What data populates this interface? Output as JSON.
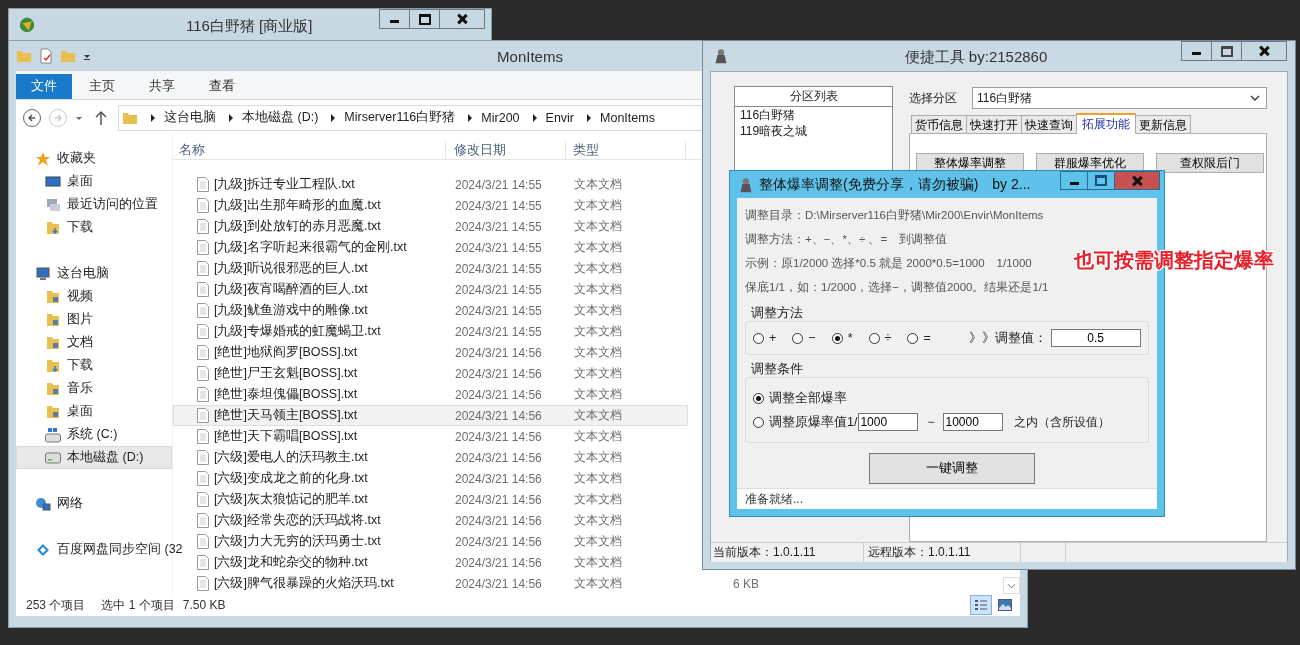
{
  "back_window": {
    "title": "116白野猪 [商业版]"
  },
  "explorer": {
    "title": "MonItems",
    "ribbon_tabs": [
      {
        "label": "文件",
        "selected": true
      },
      {
        "label": "主页",
        "selected": false
      },
      {
        "label": "共享",
        "selected": false
      },
      {
        "label": "查看",
        "selected": false
      }
    ],
    "breadcrumb": [
      "这台电脑",
      "本地磁盘 (D:)",
      "Mirserver116白野猪",
      "Mir200",
      "Envir",
      "MonItems"
    ],
    "nav": [
      {
        "label": "收藏夹",
        "kind": "star",
        "selected": false,
        "children": [
          {
            "label": "桌面",
            "kind": "desktop",
            "selected": false
          },
          {
            "label": "最近访问的位置",
            "kind": "recent",
            "selected": false
          },
          {
            "label": "下载",
            "kind": "download",
            "selected": false
          }
        ]
      },
      {
        "label": "这台电脑",
        "kind": "computer",
        "selected": false,
        "children": [
          {
            "label": "视频",
            "kind": "video",
            "selected": false
          },
          {
            "label": "图片",
            "kind": "pictures",
            "selected": false
          },
          {
            "label": "文档",
            "kind": "documents",
            "selected": false
          },
          {
            "label": "下载",
            "kind": "download",
            "selected": false
          },
          {
            "label": "音乐",
            "kind": "music",
            "selected": false
          },
          {
            "label": "桌面",
            "kind": "desktop",
            "selected": false
          },
          {
            "label": "系统 (C:)",
            "kind": "system-drive",
            "selected": false
          },
          {
            "label": "本地磁盘 (D:)",
            "kind": "drive",
            "selected": true
          }
        ]
      },
      {
        "label": "网络",
        "kind": "network",
        "selected": false
      },
      {
        "label": "百度网盘同步空间 (32",
        "kind": "cloud",
        "selected": false
      }
    ],
    "columns": [
      "名称",
      "修改日期",
      "类型"
    ],
    "rows": [
      {
        "name": "[九级]拆迁专业工程队.txt",
        "modified": "2024/3/21 14:55",
        "type": "文本文档",
        "selected": false
      },
      {
        "name": "[九级]出生那年畸形的血魔.txt",
        "modified": "2024/3/21 14:55",
        "type": "文本文档",
        "selected": false
      },
      {
        "name": "[九级]到处放钉的赤月恶魔.txt",
        "modified": "2024/3/21 14:55",
        "type": "文本文档",
        "selected": false
      },
      {
        "name": "[九级]名字听起来很霸气的金刚.txt",
        "modified": "2024/3/21 14:55",
        "type": "文本文档",
        "selected": false
      },
      {
        "name": "[九级]听说很邪恶的巨人.txt",
        "modified": "2024/3/21 14:55",
        "type": "文本文档",
        "selected": false
      },
      {
        "name": "[九级]夜宵喝醉酒的巨人.txt",
        "modified": "2024/3/21 14:55",
        "type": "文本文档",
        "selected": false
      },
      {
        "name": "[九级]鱿鱼游戏中的雕像.txt",
        "modified": "2024/3/21 14:55",
        "type": "文本文档",
        "selected": false
      },
      {
        "name": "[九级]专爆婚戒的虹魔蝎卫.txt",
        "modified": "2024/3/21 14:55",
        "type": "文本文档",
        "selected": false
      },
      {
        "name": "[绝世]地狱阎罗[BOSS].txt",
        "modified": "2024/3/21 14:56",
        "type": "文本文档",
        "selected": false
      },
      {
        "name": "[绝世]尸王玄魁[BOSS].txt",
        "modified": "2024/3/21 14:56",
        "type": "文本文档",
        "selected": false
      },
      {
        "name": "[绝世]泰坦傀儡[BOSS].txt",
        "modified": "2024/3/21 14:56",
        "type": "文本文档",
        "selected": false
      },
      {
        "name": "[绝世]天马领主[BOSS].txt",
        "modified": "2024/3/21 14:56",
        "type": "文本文档",
        "selected": true
      },
      {
        "name": "[绝世]天下霸唱[BOSS].txt",
        "modified": "2024/3/21 14:56",
        "type": "文本文档",
        "selected": false
      },
      {
        "name": "[六级]爱电人的沃玛教主.txt",
        "modified": "2024/3/21 14:56",
        "type": "文本文档",
        "selected": false
      },
      {
        "name": "[六级]变成龙之前的化身.txt",
        "modified": "2024/3/21 14:56",
        "type": "文本文档",
        "selected": false
      },
      {
        "name": "[六级]灰太狼惦记的肥羊.txt",
        "modified": "2024/3/21 14:56",
        "type": "文本文档",
        "selected": false
      },
      {
        "name": "[六级]经常失恋的沃玛战将.txt",
        "modified": "2024/3/21 14:56",
        "type": "文本文档",
        "selected": false
      },
      {
        "name": "[六级]力大无穷的沃玛勇士.txt",
        "modified": "2024/3/21 14:56",
        "type": "文本文档",
        "selected": false
      },
      {
        "name": "[六级]龙和蛇杂交的物种.txt",
        "modified": "2024/3/21 14:56",
        "type": "文本文档",
        "selected": false
      },
      {
        "name": "[六级]脾气很暴躁的火焰沃玛.txt",
        "modified": "2024/3/21 14:56",
        "type": "文本文档",
        "size": "6 KB",
        "selected": false
      }
    ],
    "status": {
      "count": "253 个项目",
      "selection": "选中 1 个项目",
      "size": "7.50 KB"
    },
    "views": [
      {
        "kind": "details",
        "selected": true
      },
      {
        "kind": "preview",
        "selected": false
      }
    ]
  },
  "tool_window": {
    "title": "便捷工具 by:2152860",
    "partition_list": {
      "header": "分区列表",
      "items": [
        "116白野猪",
        "119暗夜之城"
      ]
    },
    "select_label": "选择分区",
    "select_value": "116白野猪",
    "tabs": [
      {
        "label": "货币信息",
        "selected": false
      },
      {
        "label": "快速打开",
        "selected": false
      },
      {
        "label": "快速查询",
        "selected": false
      },
      {
        "label": "拓展功能",
        "selected": true
      },
      {
        "label": "更新信息",
        "selected": false
      }
    ],
    "buttons": [
      "整体爆率调整",
      "群服爆率优化",
      "查权限后门"
    ],
    "status": [
      "当前版本：1.0.1.11",
      "远程版本：1.0.1.11"
    ]
  },
  "dialog": {
    "title": "整体爆率调整(免费分享，请勿被骗)　by 2...",
    "info": [
      "调整目录：D:\\Mirserver116白野猪\\Mir200\\Envir\\MonItems",
      "调整方法：+、−、*、÷ 、=　到调整值",
      "示例：原1/2000 选择*0.5 就是 2000*0.5=1000　1/1000",
      "保底1/1，如：1/2000，选择−，调整值2000。结果还是1/1"
    ],
    "method": {
      "label": "调整方法",
      "options": [
        {
          "label": "+",
          "selected": false
        },
        {
          "label": "−",
          "selected": false
        },
        {
          "label": "*",
          "selected": true
        },
        {
          "label": "÷",
          "selected": false
        },
        {
          "label": "=",
          "selected": false
        }
      ],
      "value_label": "》》调整值：",
      "value": "0.5"
    },
    "condition": {
      "label": "调整条件",
      "options": [
        {
          "kind": "all",
          "label": "调整全部爆率",
          "selected": true
        },
        {
          "kind": "range",
          "label": "调整原爆率值1/",
          "from": "1000",
          "separator": "−",
          "to": "10000",
          "suffix": "之内（含所设值）",
          "selected": false
        }
      ]
    },
    "run_button": "一键调整",
    "status": "准备就绪..."
  },
  "annotation": "也可按需调整指定爆率"
}
